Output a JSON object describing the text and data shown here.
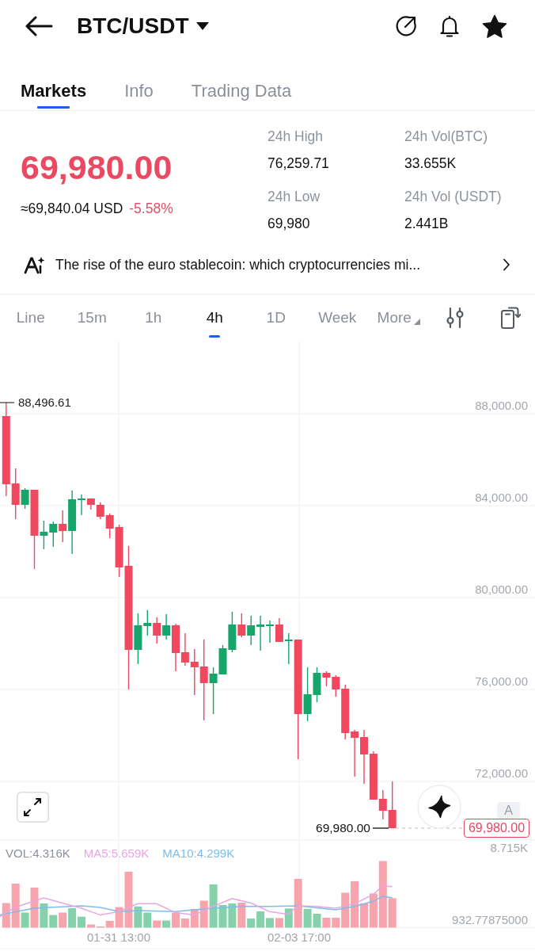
{
  "header": {
    "title": "BTC/USDT",
    "favorite": true
  },
  "tabs": [
    {
      "label": "Markets",
      "selected": true
    },
    {
      "label": "Info",
      "selected": false
    },
    {
      "label": "Trading Data",
      "selected": false
    }
  ],
  "ticker": {
    "price": "69,980.00",
    "fiat": "≈69,840.04 USD",
    "change": "-5.58%",
    "stats": [
      {
        "label": "24h High",
        "value": "76,259.71"
      },
      {
        "label": "24h Vol(BTC)",
        "value": "33.655K"
      },
      {
        "label": "24h Low",
        "value": "69,980"
      },
      {
        "label": "24h Vol (USDT)",
        "value": "2.441B"
      }
    ]
  },
  "news": {
    "headline": "The rise of the euro stablecoin: which cryptocurrencies mi..."
  },
  "intervals": {
    "items": [
      {
        "label": "Line",
        "selected": false
      },
      {
        "label": "15m",
        "selected": false
      },
      {
        "label": "1h",
        "selected": false
      },
      {
        "label": "4h",
        "selected": true
      },
      {
        "label": "1D",
        "selected": false
      },
      {
        "label": "Week",
        "selected": false
      }
    ],
    "more": "More"
  },
  "chart": {
    "price_ticks": [
      "88,000.00",
      "84,000.00",
      "80,000.00",
      "76,000.00",
      "72,000.00"
    ],
    "high_label": "88,496.61",
    "last_price": "69,980.00",
    "last_price_tag": "69,980.00",
    "scale_button": "A",
    "indicators": [
      {
        "label": "VOL:4.316K",
        "color": "#8c9198"
      },
      {
        "label": "MA5:5.659K",
        "color": "#e8a6e4"
      },
      {
        "label": "MA10:4.299K",
        "color": "#7dbde8"
      }
    ],
    "volume_max": "8.715K",
    "volume_min": "932.77875000",
    "time_labels": [
      "01-31 13:00",
      "02-03 17:00"
    ]
  }
}
